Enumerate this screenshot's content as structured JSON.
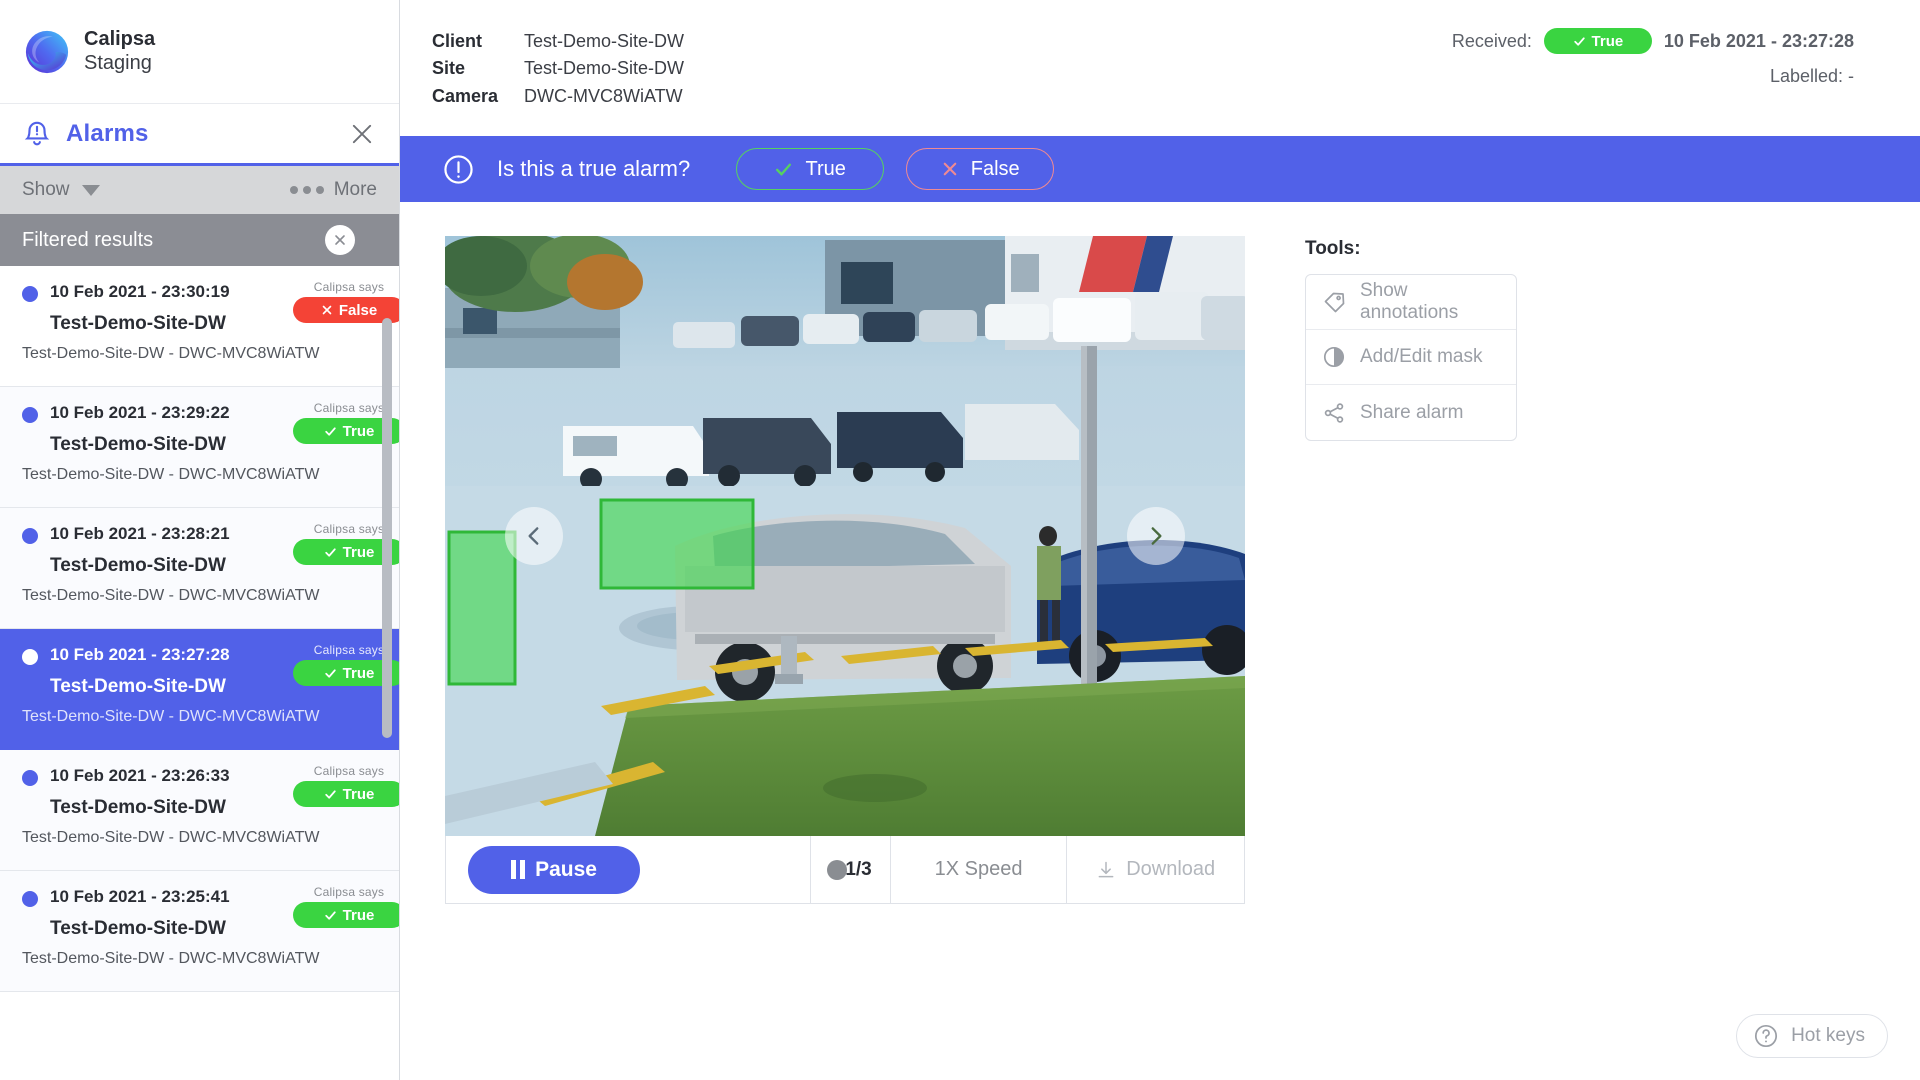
{
  "brand": {
    "name": "Calipsa",
    "environment": "Staging",
    "logo_icon": "calipsa-logo-icon"
  },
  "sidebar": {
    "panel_title": "Alarms",
    "bell_icon": "alarm-bell-icon",
    "close_icon": "close-icon",
    "toolbar": {
      "show_label": "Show",
      "caret_icon": "chevron-down-icon",
      "more_label": "More",
      "more_icon": "ellipsis-icon"
    },
    "filtered": {
      "label": "Filtered results",
      "clear_icon": "close-circle-icon"
    },
    "verdict_caption": "Calipsa says",
    "items": [
      {
        "time": "10 Feb 2021 - 23:30:19",
        "site": "Test-Demo-Site-DW",
        "camera": "Test-Demo-Site-DW - DWC-MVC8WiATW",
        "verdict": "False",
        "verdict_type": "false",
        "verdict_icon": "cross-icon",
        "selected": false
      },
      {
        "time": "10 Feb 2021 - 23:29:22",
        "site": "Test-Demo-Site-DW",
        "camera": "Test-Demo-Site-DW - DWC-MVC8WiATW",
        "verdict": "True",
        "verdict_type": "true",
        "verdict_icon": "check-icon",
        "selected": false
      },
      {
        "time": "10 Feb 2021 - 23:28:21",
        "site": "Test-Demo-Site-DW",
        "camera": "Test-Demo-Site-DW - DWC-MVC8WiATW",
        "verdict": "True",
        "verdict_type": "true",
        "verdict_icon": "check-icon",
        "selected": false
      },
      {
        "time": "10 Feb 2021 - 23:27:28",
        "site": "Test-Demo-Site-DW",
        "camera": "Test-Demo-Site-DW - DWC-MVC8WiATW",
        "verdict": "True",
        "verdict_type": "true",
        "verdict_icon": "check-icon",
        "selected": true
      },
      {
        "time": "10 Feb 2021 - 23:26:33",
        "site": "Test-Demo-Site-DW",
        "camera": "Test-Demo-Site-DW - DWC-MVC8WiATW",
        "verdict": "True",
        "verdict_type": "true",
        "verdict_icon": "check-icon",
        "selected": false
      },
      {
        "time": "10 Feb 2021 - 23:25:41",
        "site": "Test-Demo-Site-DW",
        "camera": "Test-Demo-Site-DW - DWC-MVC8WiATW",
        "verdict": "True",
        "verdict_type": "true",
        "verdict_icon": "check-icon",
        "selected": false
      }
    ]
  },
  "header": {
    "fields": [
      {
        "key": "Client",
        "value": "Test-Demo-Site-DW"
      },
      {
        "key": "Site",
        "value": "Test-Demo-Site-DW"
      },
      {
        "key": "Camera",
        "value": "DWC-MVC8WiATW"
      }
    ],
    "received_label": "Received:",
    "received_verdict": "True",
    "received_verdict_icon": "check-icon",
    "received_time": "10 Feb 2021 - 23:27:28",
    "labelled_label": "Labelled: -"
  },
  "ask": {
    "icon": "exclamation-circle-icon",
    "question": "Is this a true alarm?",
    "true_label": "True",
    "true_icon": "check-icon",
    "false_label": "False",
    "false_icon": "cross-icon"
  },
  "player": {
    "prev_icon": "chevron-left-icon",
    "next_icon": "chevron-right-icon",
    "pause_label": "Pause",
    "pause_icon": "pause-icon",
    "frame_counter": "1/3",
    "speed_label": "1X Speed",
    "download_label": "Download",
    "download_icon": "download-icon"
  },
  "tools": {
    "title": "Tools:",
    "items": [
      {
        "label": "Show annotations",
        "icon": "tag-icon"
      },
      {
        "label": "Add/Edit mask",
        "icon": "contrast-icon"
      },
      {
        "label": "Share alarm",
        "icon": "share-icon"
      }
    ]
  },
  "hotkeys": {
    "label": "Hot keys",
    "icon": "question-circle-icon"
  },
  "colors": {
    "accent": "#5161e8",
    "true_green": "#3ad441",
    "false_red": "#f44336",
    "annotation_green": "#3dd84a",
    "filtered_gray": "#8b8d94",
    "toolbar_gray": "#d6d7d9"
  }
}
